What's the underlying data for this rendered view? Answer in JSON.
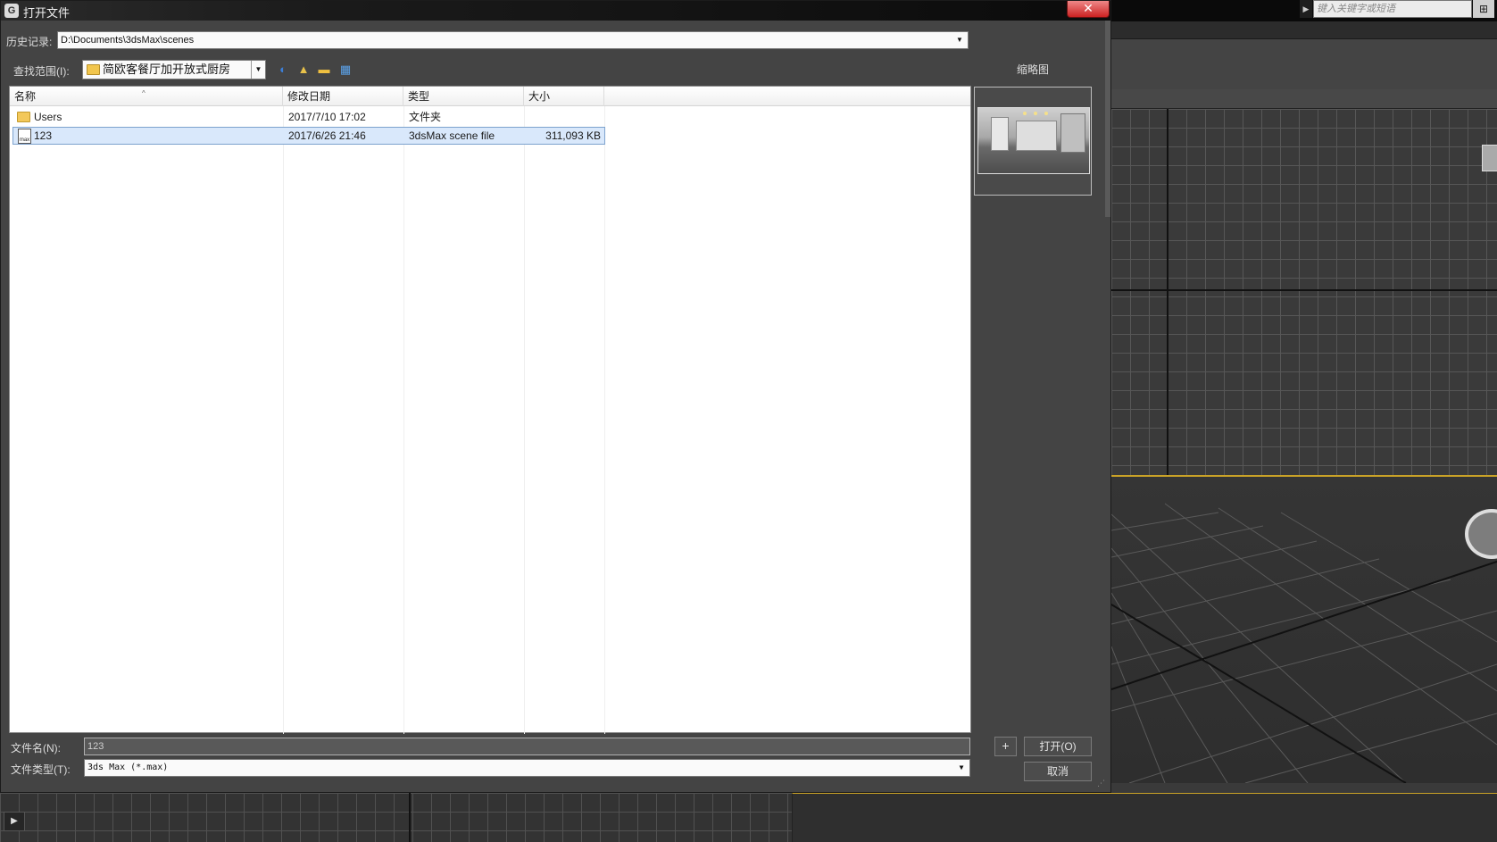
{
  "app": {
    "search_placeholder": "键入关键字或短语",
    "search_arrow": "▶",
    "help_icon": "⊞",
    "play_icon": "▶"
  },
  "dialog": {
    "title": "打开文件",
    "title_icon": "G",
    "close_icon": "✕",
    "history_label": "历史记录:",
    "history_value": "D:\\Documents\\3dsMax\\scenes",
    "lookin_label": "查找范围(I):",
    "lookin_value": "简欧客餐厅加开放式厨房",
    "dropdown_arrow": "▼",
    "toolbar": {
      "back_icon": "◐",
      "up_folder_icon": "▲",
      "new_folder_icon": "▬",
      "view_menu_icon": "▦"
    },
    "thumbnail_label": "缩略图",
    "columns": {
      "name": "名称",
      "modified": "修改日期",
      "type": "类型",
      "size": "大小",
      "sort_indicator": "^"
    },
    "rows": [
      {
        "name": "Users",
        "modified": "2017/7/10 17:02",
        "type": "文件夹",
        "size": "",
        "icon": "folder-icon",
        "selected": false
      },
      {
        "name": "123",
        "modified": "2017/6/26 21:46",
        "type": "3dsMax scene file",
        "size": "311,093 KB",
        "icon": "max-file-icon",
        "icon_text": "max",
        "selected": true
      }
    ],
    "filename_label": "文件名(N):",
    "filename_value": "123",
    "filetype_label": "文件类型(T):",
    "filetype_value": "3ds Max (*.max)",
    "plus_label": "+",
    "open_label": "打开(O)",
    "cancel_label": "取消",
    "grip_icon": "⋰"
  },
  "colors": {
    "dialog_bg": "#444444",
    "list_bg": "#ffffff",
    "selection_bg": "#d9e8fb",
    "selection_border": "#7da2ce",
    "close_red": "#cc2222",
    "viewport_active_border": "#c9a227"
  }
}
